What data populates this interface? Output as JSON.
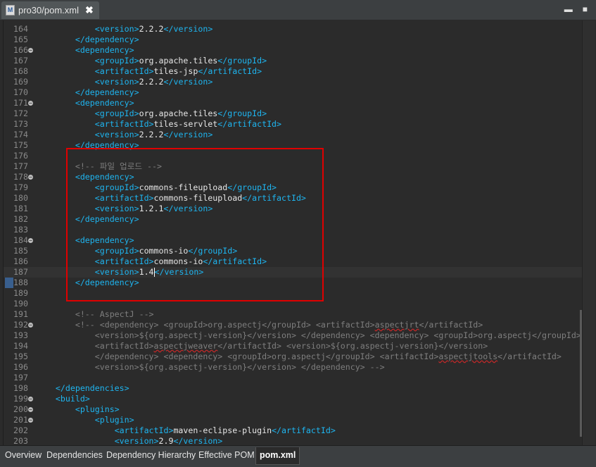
{
  "window": {
    "tab_title": "pro30/pom.xml",
    "file_icon": "M",
    "close_glyph": "✖"
  },
  "window_controls": {
    "minimize": "▬",
    "maximize": "■"
  },
  "bottom_tabs": [
    {
      "label": "Overview",
      "active": false
    },
    {
      "label": "Dependencies",
      "active": false
    },
    {
      "label": "Dependency Hierarchy",
      "active": false
    },
    {
      "label": "Effective POM",
      "active": false
    },
    {
      "label": "pom.xml",
      "active": true
    }
  ],
  "editor": {
    "current_line": 187,
    "lines": [
      {
        "n": "164",
        "fold": false,
        "indent": "            ",
        "parts": [
          [
            "t",
            "<version>"
          ],
          [
            "x",
            "2.2.2"
          ],
          [
            "t",
            "</version>"
          ]
        ]
      },
      {
        "n": "165",
        "fold": false,
        "indent": "        ",
        "parts": [
          [
            "t",
            "</dependency>"
          ]
        ]
      },
      {
        "n": "166",
        "fold": true,
        "indent": "        ",
        "parts": [
          [
            "t",
            "<dependency>"
          ]
        ]
      },
      {
        "n": "167",
        "fold": false,
        "indent": "            ",
        "parts": [
          [
            "t",
            "<groupId>"
          ],
          [
            "x",
            "org.apache.tiles"
          ],
          [
            "t",
            "</groupId>"
          ]
        ]
      },
      {
        "n": "168",
        "fold": false,
        "indent": "            ",
        "parts": [
          [
            "t",
            "<artifactId>"
          ],
          [
            "x",
            "tiles-jsp"
          ],
          [
            "t",
            "</artifactId>"
          ]
        ]
      },
      {
        "n": "169",
        "fold": false,
        "indent": "            ",
        "parts": [
          [
            "t",
            "<version>"
          ],
          [
            "x",
            "2.2.2"
          ],
          [
            "t",
            "</version>"
          ]
        ]
      },
      {
        "n": "170",
        "fold": false,
        "indent": "        ",
        "parts": [
          [
            "t",
            "</dependency>"
          ]
        ]
      },
      {
        "n": "171",
        "fold": true,
        "indent": "        ",
        "parts": [
          [
            "t",
            "<dependency>"
          ]
        ]
      },
      {
        "n": "172",
        "fold": false,
        "indent": "            ",
        "parts": [
          [
            "t",
            "<groupId>"
          ],
          [
            "x",
            "org.apache.tiles"
          ],
          [
            "t",
            "</groupId>"
          ]
        ]
      },
      {
        "n": "173",
        "fold": false,
        "indent": "            ",
        "parts": [
          [
            "t",
            "<artifactId>"
          ],
          [
            "x",
            "tiles-servlet"
          ],
          [
            "t",
            "</artifactId>"
          ]
        ]
      },
      {
        "n": "174",
        "fold": false,
        "indent": "            ",
        "parts": [
          [
            "t",
            "<version>"
          ],
          [
            "x",
            "2.2.2"
          ],
          [
            "t",
            "</version>"
          ]
        ]
      },
      {
        "n": "175",
        "fold": false,
        "indent": "        ",
        "parts": [
          [
            "t",
            "</dependency>"
          ]
        ]
      },
      {
        "n": "176",
        "fold": false,
        "indent": "",
        "parts": []
      },
      {
        "n": "177",
        "fold": false,
        "indent": "        ",
        "parts": [
          [
            "c",
            "<!-- 파일 업로드 -->"
          ]
        ]
      },
      {
        "n": "178",
        "fold": true,
        "indent": "        ",
        "parts": [
          [
            "t",
            "<dependency>"
          ]
        ]
      },
      {
        "n": "179",
        "fold": false,
        "indent": "            ",
        "parts": [
          [
            "t",
            "<groupId>"
          ],
          [
            "x",
            "commons-fileupload"
          ],
          [
            "t",
            "</groupId>"
          ]
        ]
      },
      {
        "n": "180",
        "fold": false,
        "indent": "            ",
        "parts": [
          [
            "t",
            "<artifactId>"
          ],
          [
            "x",
            "commons-fileupload"
          ],
          [
            "t",
            "</artifactId>"
          ]
        ]
      },
      {
        "n": "181",
        "fold": false,
        "indent": "            ",
        "parts": [
          [
            "t",
            "<version>"
          ],
          [
            "x",
            "1.2.1"
          ],
          [
            "t",
            "</version>"
          ]
        ]
      },
      {
        "n": "182",
        "fold": false,
        "indent": "        ",
        "parts": [
          [
            "t",
            "</dependency>"
          ]
        ]
      },
      {
        "n": "183",
        "fold": false,
        "indent": "",
        "parts": []
      },
      {
        "n": "184",
        "fold": true,
        "indent": "        ",
        "parts": [
          [
            "t",
            "<dependency>"
          ]
        ]
      },
      {
        "n": "185",
        "fold": false,
        "indent": "            ",
        "parts": [
          [
            "t",
            "<groupId>"
          ],
          [
            "x",
            "commons-io"
          ],
          [
            "t",
            "</groupId>"
          ]
        ]
      },
      {
        "n": "186",
        "fold": false,
        "indent": "            ",
        "parts": [
          [
            "t",
            "<artifactId>"
          ],
          [
            "x",
            "commons-io"
          ],
          [
            "t",
            "</artifactId>"
          ]
        ]
      },
      {
        "n": "187",
        "fold": false,
        "indent": "            ",
        "parts": [
          [
            "t",
            "<version>"
          ],
          [
            "x",
            "1.4"
          ],
          [
            "k",
            ""
          ],
          [
            "t",
            "</version>"
          ]
        ]
      },
      {
        "n": "188",
        "fold": false,
        "indent": "        ",
        "parts": [
          [
            "t",
            "</dependency>"
          ]
        ]
      },
      {
        "n": "189",
        "fold": false,
        "indent": "",
        "parts": []
      },
      {
        "n": "190",
        "fold": false,
        "indent": "",
        "parts": []
      },
      {
        "n": "191",
        "fold": false,
        "indent": "        ",
        "parts": [
          [
            "c",
            "<!-- AspectJ -->"
          ]
        ]
      },
      {
        "n": "192",
        "fold": true,
        "indent": "        ",
        "parts": [
          [
            "c",
            "<!-- <dependency> <groupId>org.aspectj</groupId> <artifactId>"
          ],
          [
            "s",
            "aspectjrt"
          ],
          [
            "c",
            "</artifactId>"
          ]
        ]
      },
      {
        "n": "193",
        "fold": false,
        "indent": "            ",
        "parts": [
          [
            "c",
            "<version>${org.aspectj-version}</version> </dependency> <dependency> <groupId>org.aspectj</groupId>"
          ]
        ]
      },
      {
        "n": "194",
        "fold": false,
        "indent": "            ",
        "parts": [
          [
            "c",
            "<artifactId>"
          ],
          [
            "s",
            "aspectjweaver"
          ],
          [
            "c",
            "</artifactId> <version>${org.aspectj-version}</version>"
          ]
        ]
      },
      {
        "n": "195",
        "fold": false,
        "indent": "            ",
        "parts": [
          [
            "c",
            "</dependency> <dependency> <groupId>org.aspectj</groupId> <artifactId>"
          ],
          [
            "s",
            "aspectjtools"
          ],
          [
            "c",
            "</artifactId>"
          ]
        ]
      },
      {
        "n": "196",
        "fold": false,
        "indent": "            ",
        "parts": [
          [
            "c",
            "<version>${org.aspectj-version}</version> </dependency> -->"
          ]
        ]
      },
      {
        "n": "197",
        "fold": false,
        "indent": "",
        "parts": []
      },
      {
        "n": "198",
        "fold": false,
        "indent": "    ",
        "parts": [
          [
            "t",
            "</dependencies>"
          ]
        ]
      },
      {
        "n": "199",
        "fold": true,
        "indent": "    ",
        "parts": [
          [
            "t",
            "<build>"
          ]
        ]
      },
      {
        "n": "200",
        "fold": true,
        "indent": "        ",
        "parts": [
          [
            "t",
            "<plugins>"
          ]
        ]
      },
      {
        "n": "201",
        "fold": true,
        "indent": "            ",
        "parts": [
          [
            "t",
            "<plugin>"
          ]
        ]
      },
      {
        "n": "202",
        "fold": false,
        "indent": "                ",
        "parts": [
          [
            "t",
            "<artifactId>"
          ],
          [
            "x",
            "maven-eclipse-plugin"
          ],
          [
            "t",
            "</artifactId>"
          ]
        ]
      },
      {
        "n": "203",
        "fold": false,
        "indent": "                ",
        "parts": [
          [
            "t",
            "<version>"
          ],
          [
            "x",
            "2.9"
          ],
          [
            "t",
            "</version>"
          ]
        ]
      }
    ]
  }
}
